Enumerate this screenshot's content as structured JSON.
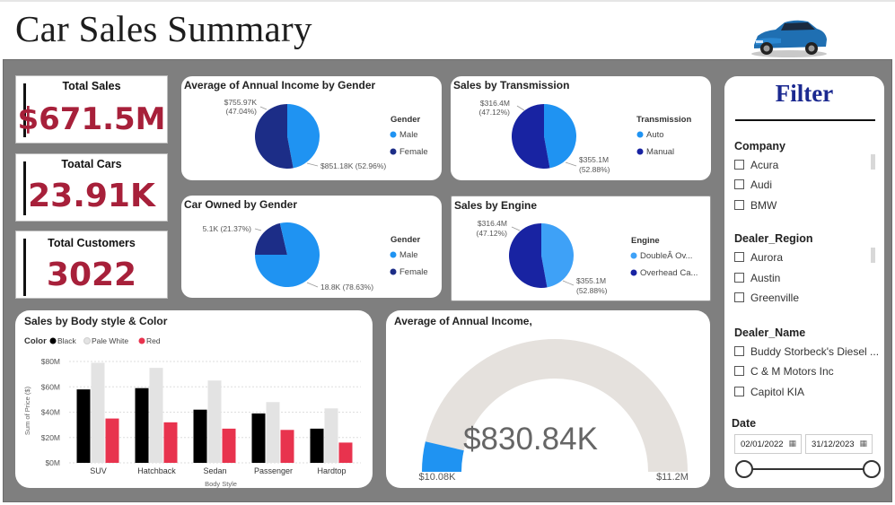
{
  "header": {
    "title": "Car Sales Summary"
  },
  "kpis": [
    {
      "label": "Total Sales",
      "value": "$671.5M"
    },
    {
      "label": "Toatal Cars",
      "value": "23.91K"
    },
    {
      "label": "Total Customers",
      "value": "3022"
    }
  ],
  "pies": {
    "income_gender": {
      "title": "Average of Annual Income by Gender",
      "legend_title": "Gender",
      "slices": [
        {
          "name": "Male",
          "label": "$755.97K",
          "pct": "(47.04%)",
          "fraction": 0.4704,
          "color": "#1f93f2"
        },
        {
          "name": "Female",
          "label": "$851.18K (52.96%)",
          "pct": "",
          "fraction": 0.5296,
          "color": "#1c2d87"
        }
      ]
    },
    "car_gender": {
      "title": "Car Owned by Gender",
      "legend_title": "Gender",
      "slices": [
        {
          "name": "Male",
          "label": "18.8K (78.63%)",
          "pct": "",
          "fraction": 0.7863,
          "color": "#1f93f2"
        },
        {
          "name": "Female",
          "label": "5.1K (21.37%)",
          "pct": "",
          "fraction": 0.2137,
          "color": "#1c2d87"
        }
      ]
    },
    "transmission": {
      "title": "Sales by Transmission",
      "legend_title": "Transmission",
      "slices": [
        {
          "name": "Auto",
          "label": "$316.4M",
          "pct": "(47.12%)",
          "fraction": 0.4712,
          "color": "#1f93f2"
        },
        {
          "name": "Manual",
          "label": "$355.1M",
          "pct": "(52.88%)",
          "fraction": 0.5288,
          "color": "#1823a2"
        }
      ]
    },
    "engine": {
      "title": "Sales by Engine",
      "legend_title": "Engine",
      "slices": [
        {
          "name": "DoubleÂ Ov...",
          "label": "$316.4M",
          "pct": "(47.12%)",
          "fraction": 0.4712,
          "color": "#3ea1f7"
        },
        {
          "name": "Overhead Ca...",
          "label": "$355.1M",
          "pct": "(52.88%)",
          "fraction": 0.5288,
          "color": "#1823a2"
        }
      ]
    }
  },
  "chart_data": [
    {
      "type": "bar",
      "title": "Sales by Body style & Color",
      "xlabel": "Body Style",
      "ylabel": "Sum of Price ($)",
      "legend_title": "Color",
      "categories": [
        "SUV",
        "Hatchback",
        "Sedan",
        "Passenger",
        "Hardtop"
      ],
      "series": [
        {
          "name": "Black",
          "color": "#000000",
          "values": [
            58,
            59,
            42,
            39,
            27
          ]
        },
        {
          "name": "Pale White",
          "color": "#e3e3e3",
          "values": [
            79,
            75,
            65,
            48,
            43
          ]
        },
        {
          "name": "Red",
          "color": "#e8334e",
          "values": [
            35,
            32,
            27,
            26,
            16
          ]
        }
      ],
      "y_ticks": [
        "$0M",
        "$20M",
        "$40M",
        "$60M",
        "$80M"
      ],
      "ylim": [
        0,
        85
      ]
    },
    {
      "type": "gauge",
      "title": "Average of Annual Income,",
      "value_label": "$830.84K",
      "min_label": "$10.08K",
      "max_label": "$11.2M",
      "value": 830.84,
      "min": 10.08,
      "max": 11200
    }
  ],
  "filter": {
    "title": "Filter",
    "company": {
      "label": "Company",
      "items": [
        "Acura",
        "Audi",
        "BMW"
      ]
    },
    "dealer_region": {
      "label": "Dealer_Region",
      "items": [
        "Aurora",
        "Austin",
        "Greenville"
      ]
    },
    "dealer_name": {
      "label": "Dealer_Name",
      "items": [
        "Buddy Storbeck's Diesel ...",
        "C & M Motors Inc",
        "Capitol KIA"
      ]
    },
    "date": {
      "label": "Date",
      "start": "02/01/2022",
      "end": "31/12/2023"
    }
  }
}
